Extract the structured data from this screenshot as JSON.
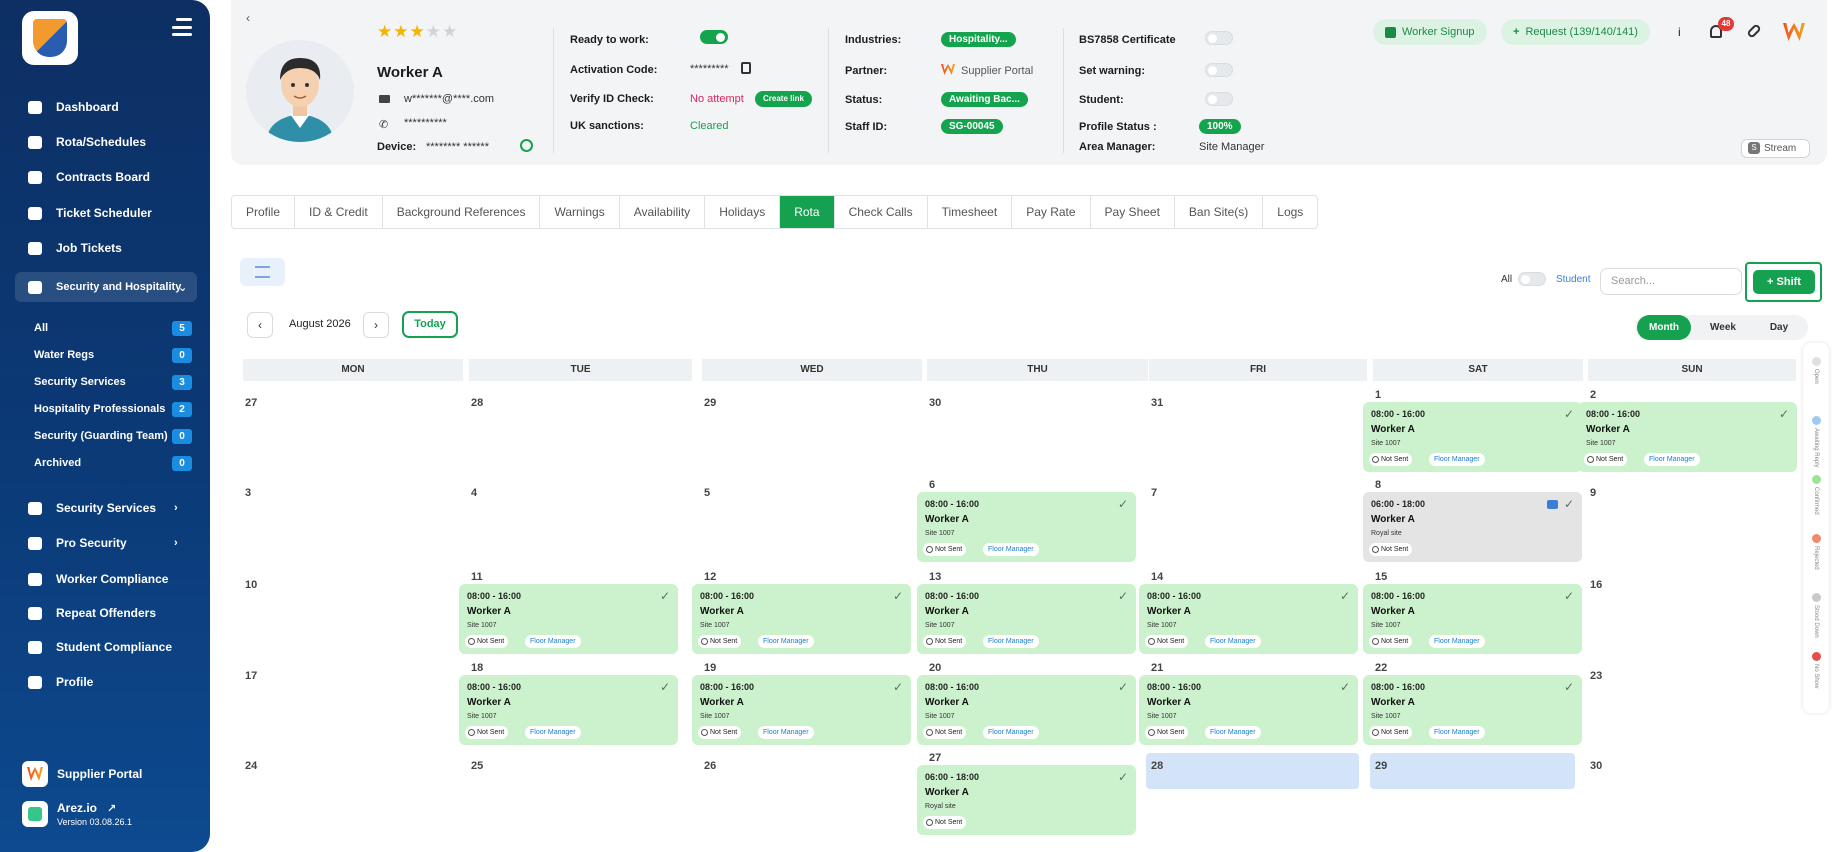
{
  "sidebar": {
    "nav": [
      {
        "label": "Dashboard",
        "icon": "dashboard-icon"
      },
      {
        "label": "Rota/Schedules",
        "icon": "calendar-icon"
      },
      {
        "label": "Contracts Board",
        "icon": "document-icon"
      },
      {
        "label": "Ticket Scheduler",
        "icon": "calendar-icon"
      },
      {
        "label": "Job Tickets",
        "icon": "tag-icon"
      },
      {
        "label": "Security and Hospitality",
        "icon": "users-icon"
      }
    ],
    "sub": [
      {
        "label": "All",
        "count": "5"
      },
      {
        "label": "Water Regs",
        "count": "0"
      },
      {
        "label": "Security Services",
        "count": "3"
      },
      {
        "label": "Hospitality Professionals",
        "count": "2"
      },
      {
        "label": "Security (Guarding Team)",
        "count": "0"
      },
      {
        "label": "Archived",
        "count": "0"
      }
    ],
    "nav2": [
      {
        "label": "Security Services",
        "icon": "users-icon"
      },
      {
        "label": "Pro Security",
        "icon": "users-icon"
      },
      {
        "label": "Worker Compliance",
        "icon": "id-card-icon"
      },
      {
        "label": "Repeat Offenders",
        "icon": "list-icon"
      },
      {
        "label": "Student Compliance",
        "icon": "id-card-icon"
      },
      {
        "label": "Profile",
        "icon": "user-icon"
      }
    ],
    "supplier_portal": "Supplier Portal",
    "arez": "Arez.io",
    "version": "Version 03.08.26.1"
  },
  "worker": {
    "name": "Worker A",
    "email": "w*******@****.com",
    "phone": "**********",
    "device_label": "Device:",
    "device": "******** ******",
    "rating": 3,
    "rating_max": 5
  },
  "info_col1": {
    "ready_label": "Ready to work:",
    "activation_label": "Activation Code:",
    "activation_value": "*********",
    "verify_label": "Verify ID Check:",
    "verify_value": "No attempt",
    "create_link": "Create link",
    "uk_label": "UK sanctions:",
    "uk_value": "Cleared"
  },
  "info_col2": {
    "industries_label": "Industries:",
    "industries_value": "Hospitality...",
    "partner_label": "Partner:",
    "partner_value": "Supplier Portal",
    "status_label": "Status:",
    "status_value": "Awaiting Bac...",
    "staff_label": "Staff ID:",
    "staff_value": "SG-00045"
  },
  "info_col3": {
    "bs_label": "BS7858 Certificate",
    "warning_label": "Set warning:",
    "student_label": "Student:",
    "profile_status_label": "Profile Status :",
    "profile_status_value": "100%",
    "area_label": "Area Manager:",
    "area_value": "Site Manager"
  },
  "header_actions": {
    "signup": "Worker Signup",
    "request": "Request (139/140/141)",
    "info": "i",
    "notifications": "48",
    "stream": "Stream"
  },
  "tabs": [
    "Profile",
    "ID & Credit",
    "Background References",
    "Warnings",
    "Availability",
    "Holidays",
    "Rota",
    "Check Calls",
    "Timesheet",
    "Pay Rate",
    "Pay Sheet",
    "Ban Site(s)",
    "Logs"
  ],
  "active_tab": "Rota",
  "toolbar": {
    "all": "All",
    "student": "Student",
    "search_placeholder": "Search...",
    "shift": "Shift",
    "month_label": "August 2026",
    "today": "Today",
    "views": [
      "Month",
      "Week",
      "Day"
    ],
    "active_view": "Month"
  },
  "calendar": {
    "days": [
      "MON",
      "TUE",
      "WED",
      "THU",
      "FRI",
      "SAT",
      "SUN"
    ],
    "weeks": [
      [
        "27",
        "28",
        "29",
        "30",
        "31",
        "1",
        "2"
      ],
      [
        "3",
        "4",
        "5",
        "6",
        "7",
        "8",
        "9"
      ],
      [
        "10",
        "11",
        "12",
        "13",
        "14",
        "15",
        "16"
      ],
      [
        "17",
        "18",
        "19",
        "20",
        "21",
        "22",
        "23"
      ],
      [
        "24",
        "25",
        "26",
        "27",
        "28",
        "29",
        "30"
      ]
    ],
    "events": [
      {
        "week": 0,
        "day": 5,
        "time": "08:00 - 16:00",
        "worker": "Worker A",
        "site": "Site 1007",
        "sent": "Not Sent",
        "role": "Floor Manager"
      },
      {
        "week": 0,
        "day": 6,
        "time": "08:00 - 16:00",
        "worker": "Worker A",
        "site": "Site 1007",
        "sent": "Not Sent",
        "role": "Floor Manager"
      },
      {
        "week": 1,
        "day": 3,
        "time": "08:00 - 16:00",
        "worker": "Worker A",
        "site": "Site 1007",
        "sent": "Not Sent",
        "role": "Floor Manager"
      },
      {
        "week": 1,
        "day": 5,
        "time": "06:00 - 18:00",
        "worker": "Worker A",
        "site": "Royal site",
        "sent": "Not Sent",
        "role": "",
        "grey": true
      },
      {
        "week": 2,
        "day": 1,
        "time": "08:00 - 16:00",
        "worker": "Worker A",
        "site": "Site 1007",
        "sent": "Not Sent",
        "role": "Floor Manager"
      },
      {
        "week": 2,
        "day": 2,
        "time": "08:00 - 16:00",
        "worker": "Worker A",
        "site": "Site 1007",
        "sent": "Not Sent",
        "role": "Floor Manager"
      },
      {
        "week": 2,
        "day": 3,
        "time": "08:00 - 16:00",
        "worker": "Worker A",
        "site": "Site 1007",
        "sent": "Not Sent",
        "role": "Floor Manager"
      },
      {
        "week": 2,
        "day": 4,
        "time": "08:00 - 16:00",
        "worker": "Worker A",
        "site": "Site 1007",
        "sent": "Not Sent",
        "role": "Floor Manager"
      },
      {
        "week": 2,
        "day": 5,
        "time": "08:00 - 16:00",
        "worker": "Worker A",
        "site": "Site 1007",
        "sent": "Not Sent",
        "role": "Floor Manager"
      },
      {
        "week": 3,
        "day": 1,
        "time": "08:00 - 16:00",
        "worker": "Worker A",
        "site": "Site 1007",
        "sent": "Not Sent",
        "role": "Floor Manager"
      },
      {
        "week": 3,
        "day": 2,
        "time": "08:00 - 16:00",
        "worker": "Worker A",
        "site": "Site 1007",
        "sent": "Not Sent",
        "role": "Floor Manager"
      },
      {
        "week": 3,
        "day": 3,
        "time": "08:00 - 16:00",
        "worker": "Worker A",
        "site": "Site 1007",
        "sent": "Not Sent",
        "role": "Floor Manager"
      },
      {
        "week": 3,
        "day": 4,
        "time": "08:00 - 16:00",
        "worker": "Worker A",
        "site": "Site 1007",
        "sent": "Not Sent",
        "role": "Floor Manager"
      },
      {
        "week": 3,
        "day": 5,
        "time": "08:00 - 16:00",
        "worker": "Worker A",
        "site": "Site 1007",
        "sent": "Not Sent",
        "role": "Floor Manager"
      },
      {
        "week": 4,
        "day": 3,
        "time": "06:00 - 18:00",
        "worker": "Worker A",
        "site": "Royal site",
        "sent": "Not Sent",
        "role": ""
      }
    ]
  },
  "legend": [
    {
      "label": "Open",
      "color": "#e0e0e0"
    },
    {
      "label": "Awaiting Reply",
      "color": "#9ec9f0"
    },
    {
      "label": "Confirmed",
      "color": "#9ee29a"
    },
    {
      "label": "Rejected",
      "color": "#f08a6a"
    },
    {
      "label": "Stood Down",
      "color": "#c9c9c9"
    },
    {
      "label": "No Show",
      "color": "#e05050"
    }
  ]
}
